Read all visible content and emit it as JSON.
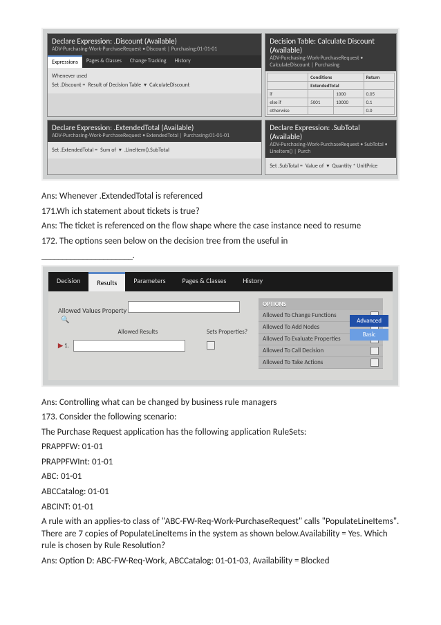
{
  "screenshot1": {
    "panel_a": {
      "title": "Declare Expression: .Discount (Available)",
      "crumb": "ADV-Purchasing-Work-PurchaseRequest • Discount | Purchasing:01-01-01",
      "tabs": [
        "Expressions",
        "Pages & Classes",
        "Change Tracking",
        "History"
      ],
      "row1": "Whenever used",
      "row2_label": "Set .Discount =",
      "row2_mid": "Result of Decision Table",
      "row2_right": "CalculateDiscount"
    },
    "panel_b": {
      "title": "Decision Table: Calculate Discount (Available)",
      "crumb": "ADV-Purchasing-Work-PurchaseRequest • CalculateDiscount | Purchasing",
      "cond_label": "Conditions",
      "col1": "ExtendedTotal",
      "ret": "Return",
      "rows": [
        {
          "c1": "if",
          "c2": "",
          "c3": "1000",
          "r": "0.05"
        },
        {
          "c1": "else if",
          "c2": "5001",
          "c3": "10000",
          "r": "0.1"
        },
        {
          "c1": "otherwise",
          "c2": "",
          "c3": "",
          "r": "0.0"
        }
      ]
    },
    "panel_c": {
      "title": "Declare Expression: .ExtendedTotal (Available)",
      "crumb": "ADV-Purchasing-Work-PurchaseRequest • ExtendedTotal | Purchasing:01-01-01",
      "row_label": "Set .ExtendedTotal =",
      "row_mid": "Sum of",
      "row_right": ".LineItem().SubTotal"
    },
    "panel_d": {
      "title": "Declare Expression: .SubTotal (Available)",
      "crumb": "ADV-Purchasing-Work-PurchaseRequest • SubTotal • LineItem() | Purch",
      "row_label": "Set .SubTotal =",
      "row_mid": "Value of",
      "row_right": "Quantity * UnitPrice"
    }
  },
  "q171": {
    "ans_before": "Ans: Whenever .ExtendedTotal is referenced",
    "q": "171.Wh ich statement about tickets is true?",
    "a": "Ans: The ticket is referenced on the flow shape where the case instance need to resume"
  },
  "q172": {
    "q": "172. The options seen below on the decision tree from the useful in",
    "blank": "______________________.",
    "ans": "Ans: Controlling what can be changed by business rule managers"
  },
  "screenshot2": {
    "tabs": [
      "Decision",
      "Results",
      "Parameters",
      "Pages & Classes",
      "History"
    ],
    "label_avp": "Allowed Values Property",
    "label_ar": "Allowed Results",
    "label_sp": "Sets Properties?",
    "row_num": "1.",
    "options_title": "OPTIONS",
    "options": [
      "Allowed To Change Functions",
      "Allowed To Add Nodes",
      "Allowed To Evaluate Properties",
      "Allowed To Call Decision",
      "Allowed To Take Actions"
    ],
    "advanced": "Advanced",
    "basic": "Basic"
  },
  "q173": {
    "l1": "173. Consider the following scenario:",
    "l2": "The Purchase Request application has the following application RuleSets:",
    "r1": "PRAPPFW: 01-01",
    "r2": "PRAPPFWInt: 01-01",
    "r3": "ABC: 01-01",
    "r4": "ABCCatalog: 01-01",
    "r5": "ABCINT: 01-01",
    "l3": "A rule with an applies-to class of \"ABC-FW-Req-Work-PurchaseRequest\" calls \"PopulateLineItems\". There are 7 copies of PopulateLineItems in the system as shown below.Availability = Yes. Which rule is chosen by Rule Resolution?",
    "ans": "Ans: Option D: ABC-FW-Req-Work, ABCCatalog: 01-01-03, Availability = Blocked"
  }
}
